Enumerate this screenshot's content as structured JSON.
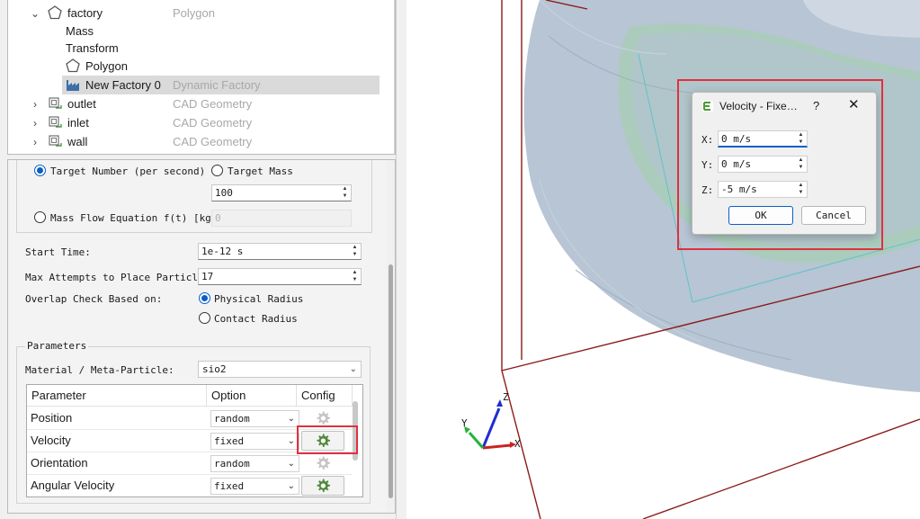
{
  "tree": {
    "items": [
      {
        "name": "factory",
        "type": "Polygon",
        "icon": "polygon-icon",
        "expand": "expanded"
      },
      {
        "name": "Mass",
        "type": "",
        "icon": ""
      },
      {
        "name": "Transform",
        "type": "",
        "icon": ""
      },
      {
        "name": "Polygon",
        "type": "",
        "icon": "polygon-icon"
      },
      {
        "name": "New Factory 0",
        "type": "Dynamic Factory",
        "icon": "factory-icon",
        "selected": true
      },
      {
        "name": "outlet",
        "type": "CAD Geometry",
        "icon": "cad-geometry-icon",
        "expand": "collapsed"
      },
      {
        "name": "inlet",
        "type": "CAD Geometry",
        "icon": "cad-geometry-icon",
        "expand": "collapsed"
      },
      {
        "name": "wall",
        "type": "CAD Geometry",
        "icon": "cad-geometry-icon",
        "expand": "collapsed"
      }
    ]
  },
  "generation": {
    "target_number_label": "Target Number (per second)",
    "target_mass_label": "Target Mass",
    "target_value": "100",
    "mass_flow_label": "Mass Flow Equation f(t) [kg]",
    "mass_flow_value": "0",
    "selected": "target_number"
  },
  "timing": {
    "start_time_label": "Start Time:",
    "start_time_value": "1e-12 s",
    "max_attempts_label": "Max Attempts to Place Particle:",
    "max_attempts_value": "17",
    "overlap_label": "Overlap Check Based on:",
    "physical_radius_label": "Physical Radius",
    "contact_radius_label": "Contact Radius",
    "overlap_selected": "physical_radius"
  },
  "parameters": {
    "group_title": "Parameters",
    "material_label": "Material / Meta-Particle:",
    "material_value": "sio2",
    "columns": [
      "Parameter",
      "Option",
      "Config"
    ],
    "rows": [
      {
        "parameter": "Position",
        "option": "random",
        "config_enabled": false
      },
      {
        "parameter": "Velocity",
        "option": "fixed",
        "config_enabled": true
      },
      {
        "parameter": "Orientation",
        "option": "random",
        "config_enabled": false
      },
      {
        "parameter": "Angular Velocity",
        "option": "fixed",
        "config_enabled": true
      }
    ]
  },
  "axes": {
    "x": "X",
    "y": "Y",
    "z": "Z"
  },
  "dialog": {
    "title": "Velocity - Fixe…",
    "help": "?",
    "close": "✕",
    "x_label": "X:",
    "x_value": "0 m/s",
    "y_label": "Y:",
    "y_value": "0 m/s",
    "z_label": "Z:",
    "z_value": "-5 m/s",
    "ok_label": "OK",
    "cancel_label": "Cancel"
  },
  "colors": {
    "highlight": "#e03040",
    "accent": "#0a5fc8",
    "bounding_box": "#8b1a1a",
    "geometry_fill": "#b7c5d4",
    "geometry_inner": "#a9cdb8"
  }
}
